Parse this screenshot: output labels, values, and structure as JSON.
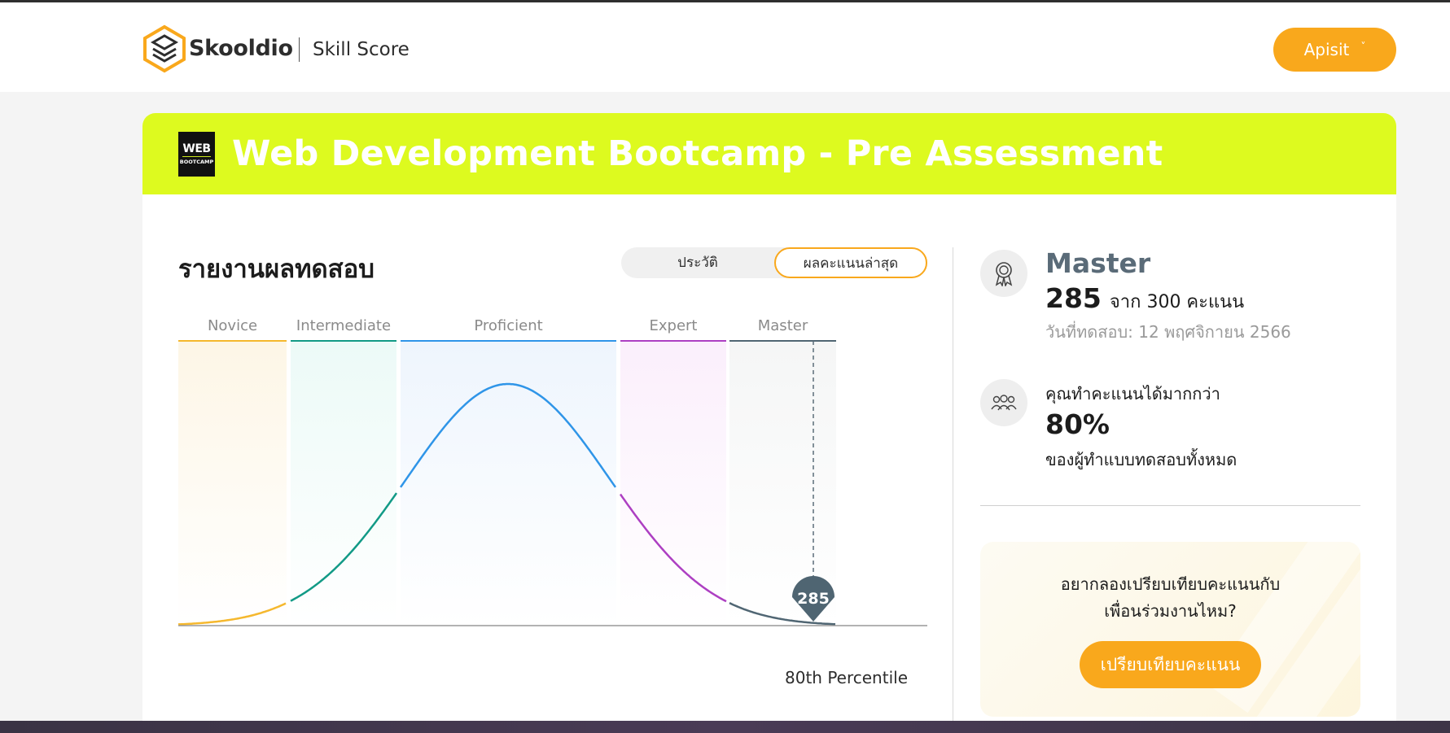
{
  "header": {
    "brand": "Skooldio",
    "product": "Skill Score",
    "user_name": "Apisit",
    "user_chevron": "˅"
  },
  "course": {
    "logo_top": "WEB",
    "logo_bottom": "BOOTCAMP",
    "title": "Web Development Bootcamp - Pre Assessment"
  },
  "report": {
    "title": "รายงานผลทดสอบ",
    "tabs": [
      "ประวัติ",
      "ผลคะแนนล่าสุด"
    ],
    "active_tab": 1,
    "percentile_label": "80th Percentile"
  },
  "chart_data": {
    "type": "area",
    "title": "",
    "levels": [
      {
        "name": "Novice",
        "color": "#f5b82e"
      },
      {
        "name": "Intermediate",
        "color": "#129a86"
      },
      {
        "name": "Proficient",
        "color": "#2f95e8"
      },
      {
        "name": "Expert",
        "color": "#ad3fc2"
      },
      {
        "name": "Master",
        "color": "#506673"
      }
    ],
    "marker": {
      "score": 285,
      "label": "285"
    },
    "distribution": "normal"
  },
  "result": {
    "level": "Master",
    "score": "285",
    "out_of": "จาก 300 คะแนน",
    "date": "วันที่ทดสอบ: 12 พฤศจิกายน 2566",
    "more_than_label": "คุณทำคะแนนได้มากกว่า",
    "percent": "80%",
    "all_takers": "ของผู้ทำแบบทดสอบทั้งหมด"
  },
  "cta": {
    "line1": "อยากลองเปรียบเทียบคะแนนกับ",
    "line2": "เพื่อนร่วมงานไหม?",
    "button": "เปรียบเทียบคะแนน"
  },
  "icons": {
    "award": "award-icon",
    "people": "people-icon"
  },
  "colors": {
    "accent": "#f9a81c",
    "banner": "#ddfa1f",
    "level_title": "#5a6b78"
  }
}
